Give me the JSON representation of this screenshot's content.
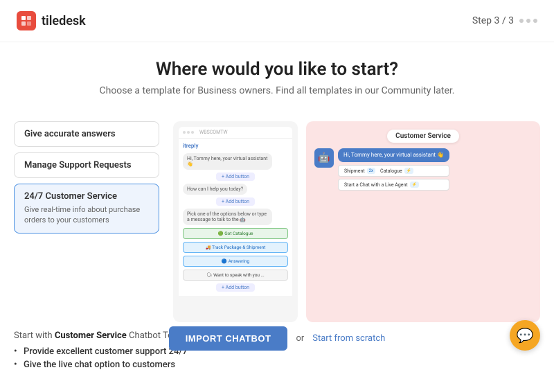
{
  "header": {
    "logo_text": "tiledesk",
    "step_label": "Step",
    "step_current": "3",
    "step_total": "3"
  },
  "main": {
    "title": "Where would you like to start?",
    "subtitle": "Choose a template for Business owners. Find all templates in our Community later."
  },
  "templates": [
    {
      "id": "accurate-answers",
      "label": "Give accurate answers",
      "desc": "",
      "active": false
    },
    {
      "id": "manage-support",
      "label": "Manage Support Requests",
      "desc": "",
      "active": false
    },
    {
      "id": "customer-service",
      "label": "24/7 Customer Service",
      "desc": "Give real-time info about purchase orders to your customers",
      "active": true
    }
  ],
  "preview": {
    "header_text": "WBSCOMTW",
    "bot_label": "itreply",
    "bubble1": "Hi, Tommy here, your virtual assistant 👋",
    "bubble2": "How can I help you today?",
    "bubble3": "Pick one of the options below or type a message to talk to the 🤖",
    "options": [
      {
        "label": "🟢 Got Catalogue",
        "type": "green"
      },
      {
        "label": "🚚 Track Package & Shipment",
        "type": "blue"
      },
      {
        "label": "🔵 Answering",
        "type": "blue"
      },
      {
        "label": "🗣 Want to speak with you ...",
        "type": ""
      }
    ]
  },
  "cs_preview": {
    "badge": "Customer Service",
    "bubble": "Hi, Tommy here, your virtual assistant 👋",
    "options": [
      {
        "label": "Shipment",
        "tag": "2x",
        "label2": "Catalogue",
        "tag2": "⚡"
      },
      {
        "label": "Start a Chat with a Live Agent",
        "tag": "⚡"
      }
    ]
  },
  "description": {
    "prefix": "Start with ",
    "template_name": "Customer Service",
    "suffix": " Chatbot Template, perfect for:",
    "bullets": [
      "Provide excellent customer support 24/7",
      "Give the live chat option to customers"
    ]
  },
  "footer": {
    "import_label": "IMPORT CHATBOT",
    "or_text": "or",
    "scratch_label": "Start from scratch"
  }
}
